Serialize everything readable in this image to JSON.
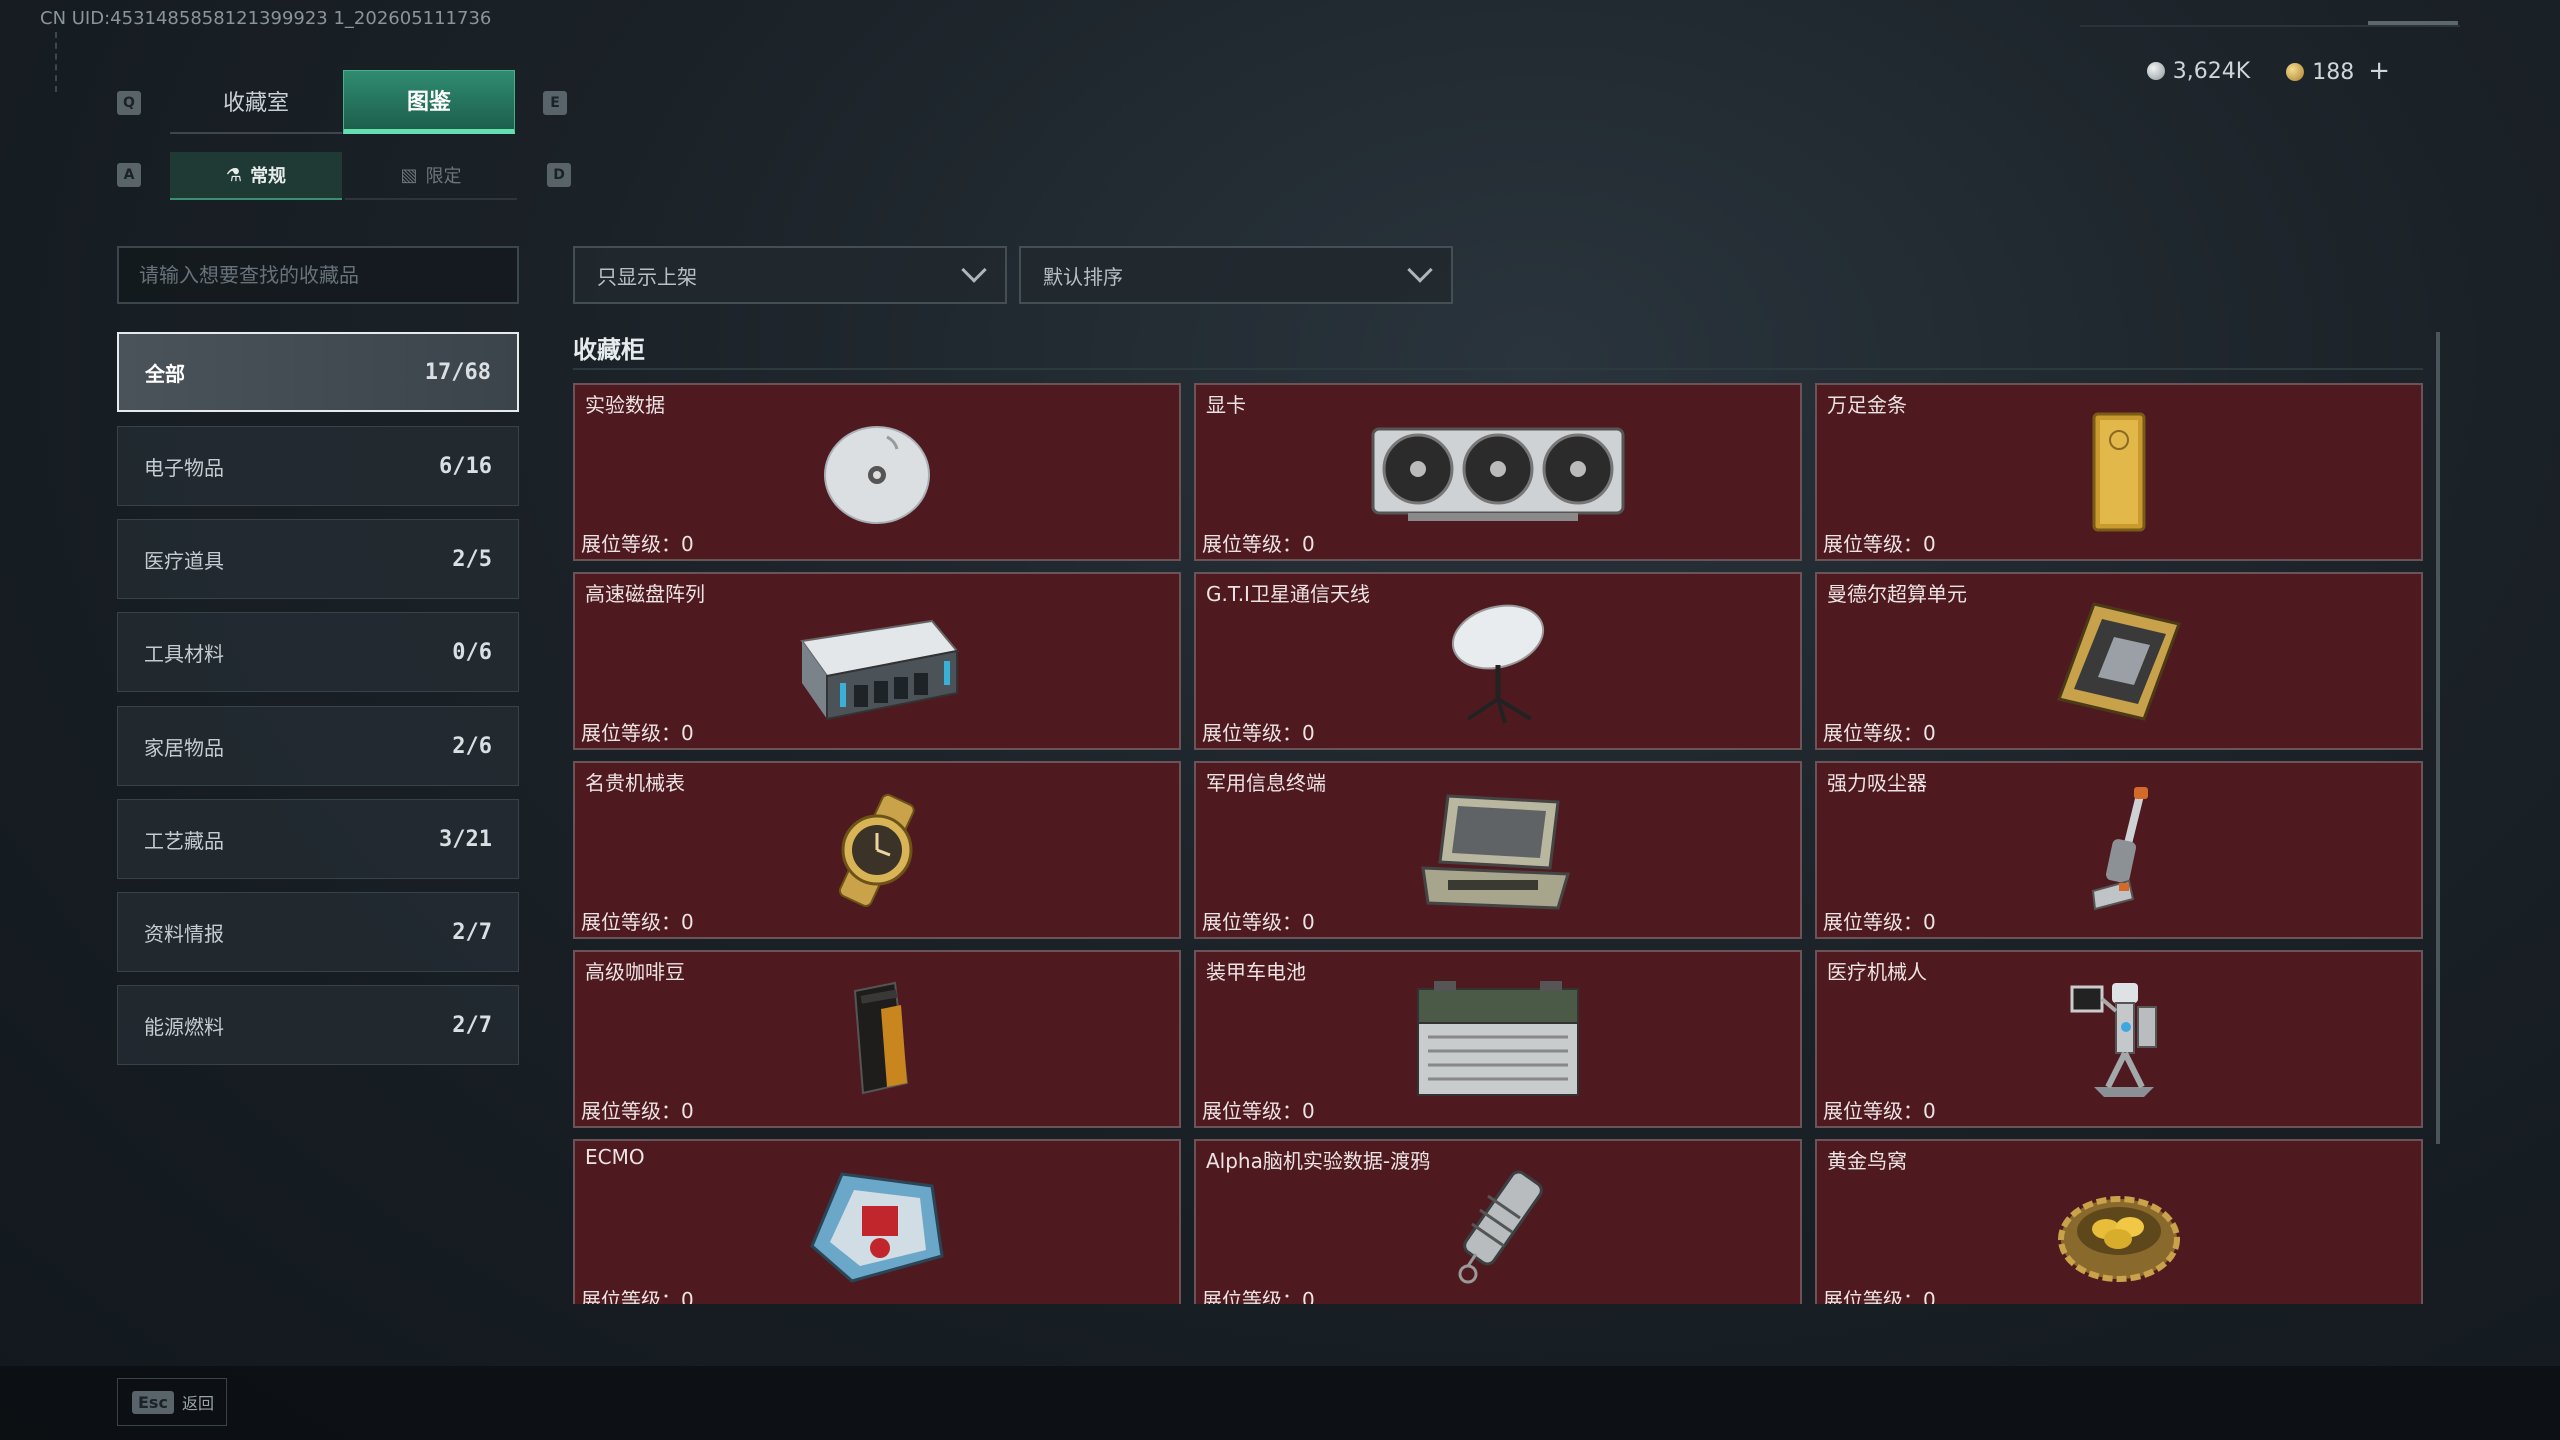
{
  "uid_text": "CN UID:4531485858121399923 1_202605111736",
  "top_tabs": {
    "q_key": "Q",
    "e_key": "E",
    "collection": "收藏室",
    "codex": "图鉴"
  },
  "sub_tabs": {
    "a_key": "A",
    "d_key": "D",
    "regular": "常规",
    "limited": "限定"
  },
  "currency": {
    "silver": "3,624K",
    "gold": "188",
    "plus": "+"
  },
  "search": {
    "placeholder": "请输入想要查找的收藏品"
  },
  "filters": {
    "display": "只显示上架",
    "sort": "默认排序"
  },
  "categories": [
    {
      "label": "全部",
      "count": "17/68",
      "active": true
    },
    {
      "label": "电子物品",
      "count": "6/16"
    },
    {
      "label": "医疗道具",
      "count": "2/5"
    },
    {
      "label": "工具材料",
      "count": "0/6"
    },
    {
      "label": "家居物品",
      "count": "2/6"
    },
    {
      "label": "工艺藏品",
      "count": "3/21"
    },
    {
      "label": "资料情报",
      "count": "2/7"
    },
    {
      "label": "能源燃料",
      "count": "2/7"
    }
  ],
  "section_title": "收藏柜",
  "level_label": "展位等级：0",
  "items": [
    {
      "name": "实验数据",
      "icon": "disc-icon"
    },
    {
      "name": "显卡",
      "icon": "graphics-card-icon"
    },
    {
      "name": "万足金条",
      "icon": "gold-bar-icon"
    },
    {
      "name": "高速磁盘阵列",
      "icon": "disk-array-icon"
    },
    {
      "name": "G.T.I卫星通信天线",
      "icon": "satellite-antenna-icon"
    },
    {
      "name": "曼德尔超算单元",
      "icon": "supercomputer-unit-icon"
    },
    {
      "name": "名贵机械表",
      "icon": "watch-icon"
    },
    {
      "name": "军用信息终端",
      "icon": "military-terminal-icon"
    },
    {
      "name": "强力吸尘器",
      "icon": "vacuum-icon"
    },
    {
      "name": "高级咖啡豆",
      "icon": "coffee-bag-icon"
    },
    {
      "name": "装甲车电池",
      "icon": "battery-icon"
    },
    {
      "name": "医疗机械人",
      "icon": "medical-robot-icon"
    },
    {
      "name": "ECMO",
      "icon": "ecmo-icon"
    },
    {
      "name": "Alpha脑机实验数据-渡鸦",
      "icon": "data-canister-icon"
    },
    {
      "name": "黄金鸟窝",
      "icon": "golden-nest-icon"
    }
  ],
  "bottom": {
    "esc_key": "Esc",
    "back": "返回"
  },
  "colors": {
    "accent": "#2f8c70",
    "card_bg": "#4f1a1f",
    "card_border": "#6b5358"
  }
}
